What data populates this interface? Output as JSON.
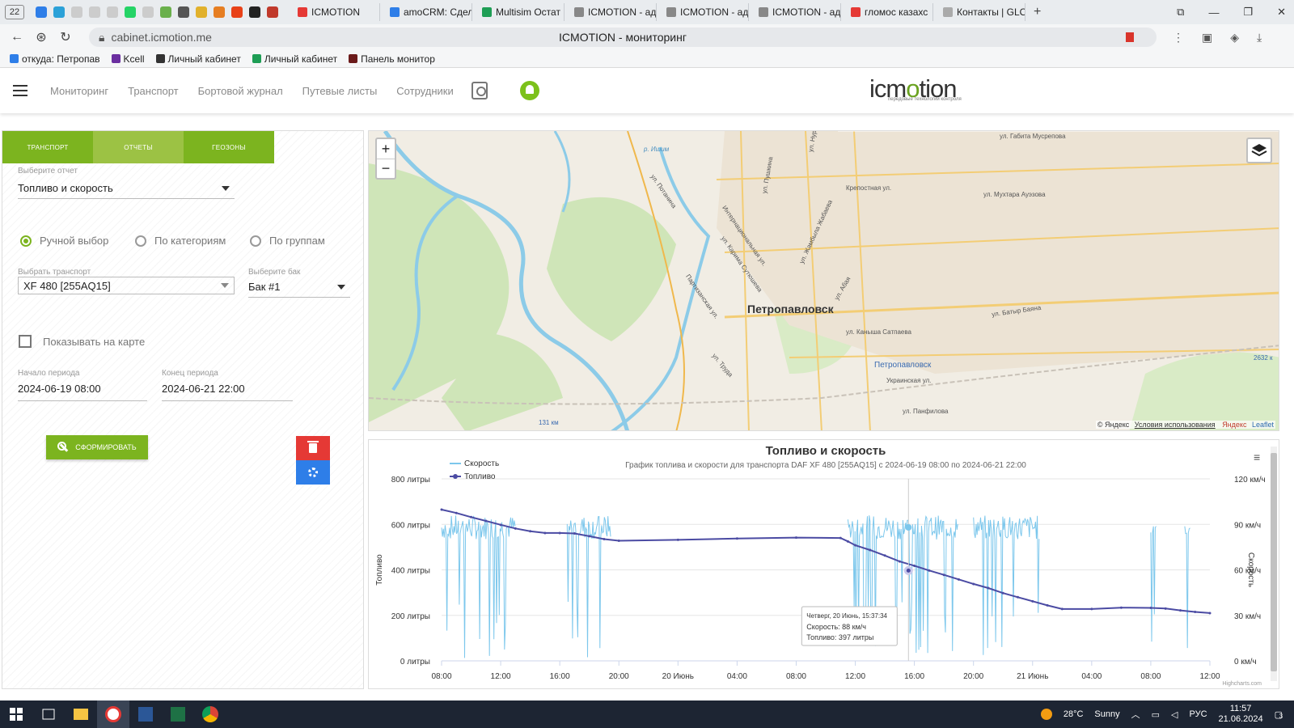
{
  "browser": {
    "tab_count": "22",
    "tabs": [
      {
        "label": "ICMOTION",
        "color": "#e53935"
      },
      {
        "label": "amoCRM: Сдел",
        "color": "#2e7ee8"
      },
      {
        "label": "Multisim Остат",
        "color": "#1e9e55"
      },
      {
        "label": "ICMOTION - ад",
        "color": "#888888"
      },
      {
        "label": "ICMOTION - ад",
        "color": "#888888"
      },
      {
        "label": "ICMOTION - ад",
        "color": "#888888"
      },
      {
        "label": "гломос казахс",
        "color": "#e53935"
      },
      {
        "label": "Контакты | GLO",
        "color": "#aaaaaa"
      }
    ],
    "url": "cabinet.icmotion.me",
    "page_title": "ICMOTION - мониторинг",
    "bookmarks": [
      {
        "label": "откуда: Петропав",
        "color": "#2e7ee8"
      },
      {
        "label": "Kcell",
        "color": "#6b2fa0"
      },
      {
        "label": "Личный кабинет",
        "color": "#333333"
      },
      {
        "label": "Личный кабинет",
        "color": "#1e9e55"
      },
      {
        "label": "Панель монитор",
        "color": "#6b1a1a"
      }
    ]
  },
  "header": {
    "nav": [
      "Мониторинг",
      "Транспорт",
      "Бортовой журнал",
      "Путевые листы",
      "Сотрудники"
    ],
    "logo_pre": "icm",
    "logo_o": "o",
    "logo_post": "tion",
    "logo_sub": "передовые технологии контроля"
  },
  "panel": {
    "tabs": [
      "Транспорт",
      "Отчеты",
      "Геозоны"
    ],
    "report_label": "Выберите отчет",
    "report_value": "Топливо и скорость",
    "radios": [
      {
        "label": "Ручной выбор",
        "checked": true
      },
      {
        "label": "По категориям",
        "checked": false
      },
      {
        "label": "По группам",
        "checked": false
      }
    ],
    "vehicle_label": "Выбрать транспорт",
    "vehicle_value": "XF 480 [255AQ15]",
    "tank_label": "Выберите бак",
    "tank_value": "Бак #1",
    "show_on_map": "Показывать на карте",
    "start_label": "Начало периода",
    "start_value": "2024-06-19 08:00",
    "end_label": "Конец периода",
    "end_value": "2024-06-21 22:00",
    "build_button": "СФОРМИРОВАТЬ"
  },
  "map": {
    "city": "Петропавловск",
    "streets": [
      "ул. Габита Мусрепова",
      "ул. Мухтара Ауэзова",
      "Крепостная ул.",
      "ул. Потанина",
      "ул. Пушкина",
      "Интернациональная ул.",
      "ул. Жамбыла Жабаева",
      "ул. Карима Сутюшева",
      "Партизанская ул.",
      "ул. Абая",
      "ул. Батыр Баяна",
      "ул. Каныша Сатпаева",
      "ул. Труда",
      "Украинская ул.",
      "ул. Панфилова",
      "ул. Нур"
    ],
    "station": "Петропавловск",
    "km1": "131 км",
    "km2": "2632 к",
    "river": "р. Ишим",
    "attribution": "© Яндекс",
    "terms": "Условия использования",
    "leaflet": "Leaflet",
    "layers_label": "Яндекс"
  },
  "chart_data": {
    "type": "line",
    "title": "Топливо и скорость",
    "subtitle": "График топлива и скорости для транспорта DAF XF 480 [255AQ15] с 2024-06-19 08:00 по 2024-06-21 22:00",
    "ylabel_left": "Топливо",
    "ylabel_right": "Скорость",
    "ylim_left": [
      0,
      800
    ],
    "ylim_right": [
      0,
      120
    ],
    "y_left_ticks": [
      "0 литры",
      "200 литры",
      "400 литры",
      "600 литры",
      "800 литры"
    ],
    "y_right_ticks": [
      "0 км/ч",
      "30 км/ч",
      "60 км/ч",
      "90 км/ч",
      "120 км/ч"
    ],
    "x_ticks": [
      "08:00",
      "12:00",
      "16:00",
      "20:00",
      "20 Июнь",
      "04:00",
      "08:00",
      "12:00",
      "16:00",
      "20:00",
      "21 Июнь",
      "04:00",
      "08:00",
      "12:00"
    ],
    "x_range_hours": [
      0,
      52
    ],
    "series": [
      {
        "name": "Скорость",
        "color": "#7cc7ec",
        "axis": "right",
        "active_intervals_hours": [
          [
            0,
            5
          ],
          [
            8.5,
            11.5
          ],
          [
            27.5,
            35
          ],
          [
            36,
            40.5
          ],
          [
            48,
            48.4
          ],
          [
            50.3,
            50.7
          ]
        ],
        "cruise_kmh": 88
      },
      {
        "name": "Топливо",
        "color": "#4b4ba3",
        "axis": "left",
        "x": [
          0,
          1,
          2,
          3,
          4,
          5,
          6,
          7,
          8,
          9,
          10,
          11,
          12,
          16,
          20,
          24,
          27,
          27.5,
          28,
          29,
          30,
          31,
          32,
          33,
          34,
          35,
          36,
          37,
          38,
          39,
          40,
          41,
          42,
          44,
          46,
          48,
          49,
          50,
          51,
          52
        ],
        "y": [
          665,
          650,
          632,
          615,
          598,
          582,
          570,
          562,
          562,
          560,
          548,
          535,
          528,
          532,
          538,
          542,
          540,
          525,
          508,
          487,
          463,
          437,
          418,
          397,
          378,
          358,
          338,
          320,
          298,
          280,
          262,
          244,
          228,
          228,
          234,
          233,
          230,
          222,
          215,
          210
        ]
      }
    ],
    "tooltip": {
      "date": "Четверг, 20 Июнь, 15:37:34",
      "speed": "Скорость: 88 км/ч",
      "fuel": "Топливо: 397 литры",
      "x": 31.6
    },
    "credit": "Highcharts.com"
  },
  "taskbar": {
    "weather_temp": "28°C",
    "weather_text": "Sunny",
    "lang": "РУС",
    "time": "11:57",
    "date": "21.06.2024",
    "notif": "3"
  }
}
